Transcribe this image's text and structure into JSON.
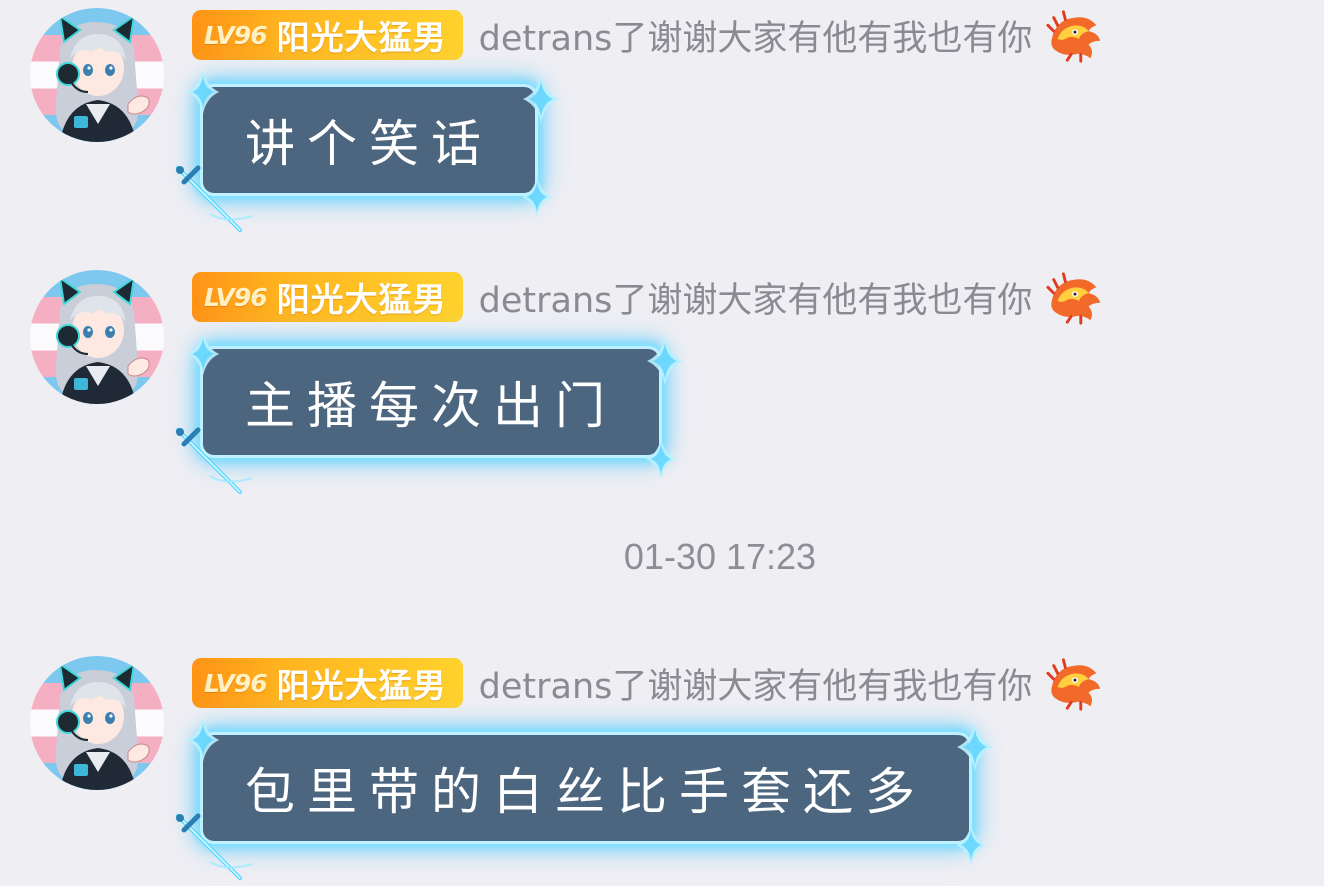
{
  "messages": [
    {
      "user": {
        "level": "LV96",
        "badge_name": "阳光大猛男",
        "username": "detrans了谢谢大家有他有我也有你",
        "avatar_icon": "anime-girl-avatar",
        "decoration_icon": "dragon-icon"
      },
      "text": "讲个笑话"
    },
    {
      "user": {
        "level": "LV96",
        "badge_name": "阳光大猛男",
        "username": "detrans了谢谢大家有他有我也有你",
        "avatar_icon": "anime-girl-avatar",
        "decoration_icon": "dragon-icon"
      },
      "text": "主播每次出门"
    },
    {
      "user": {
        "level": "LV96",
        "badge_name": "阳光大猛男",
        "username": "detrans了谢谢大家有他有我也有你",
        "avatar_icon": "anime-girl-avatar",
        "decoration_icon": "dragon-icon"
      },
      "text": "包里带的白丝比手套还多"
    }
  ],
  "timestamp": "01-30 17:23",
  "colors": {
    "background": "#efeef3",
    "bubble": "#4d6680",
    "bubble_glow": "#7fe3ff",
    "badge_start": "#ff9316",
    "badge_end": "#ffd22d",
    "username": "#8b8a92",
    "timestamp": "#8e8d95"
  }
}
